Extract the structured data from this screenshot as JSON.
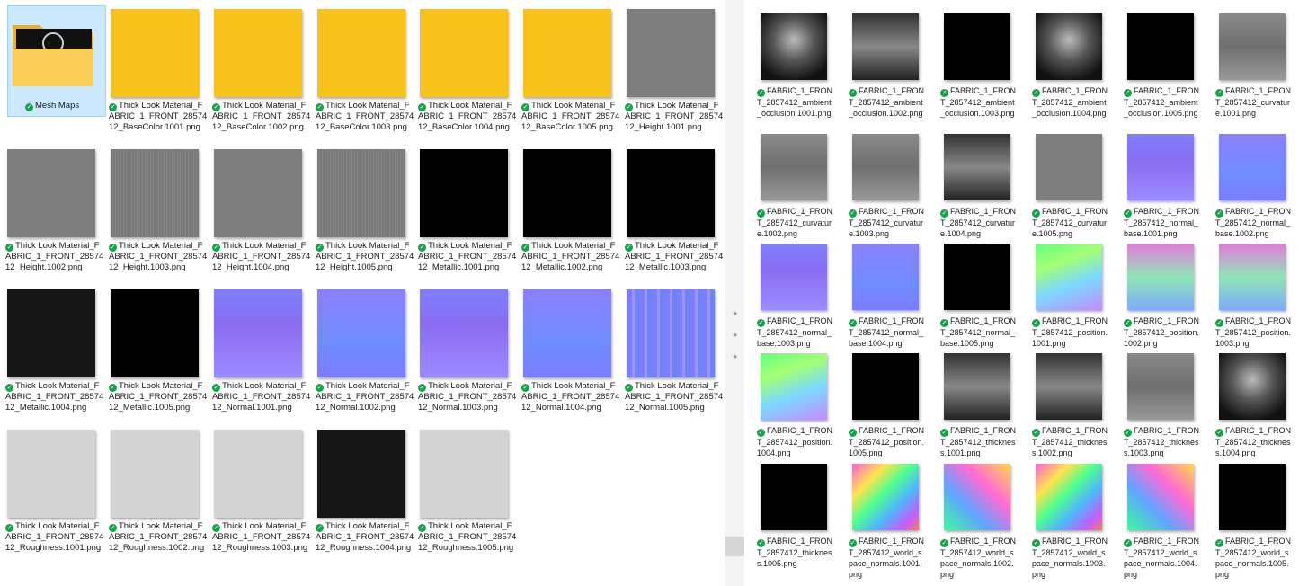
{
  "left_folder": {
    "folder_label": "Mesh Maps",
    "files": [
      {
        "name": "Thick Look Material_FABRIC_1_FRONT_2857412_BaseColor.1001.png",
        "pattern": "p-yellow"
      },
      {
        "name": "Thick Look Material_FABRIC_1_FRONT_2857412_BaseColor.1002.png",
        "pattern": "p-yellow"
      },
      {
        "name": "Thick Look Material_FABRIC_1_FRONT_2857412_BaseColor.1003.png",
        "pattern": "p-yellow"
      },
      {
        "name": "Thick Look Material_FABRIC_1_FRONT_2857412_BaseColor.1004.png",
        "pattern": "p-yellow-sun"
      },
      {
        "name": "Thick Look Material_FABRIC_1_FRONT_2857412_BaseColor.1005.png",
        "pattern": "p-yellow"
      },
      {
        "name": "Thick Look Material_FABRIC_1_FRONT_2857412_Height.1001.png",
        "pattern": "p-gray"
      },
      {
        "name": "Thick Look Material_FABRIC_1_FRONT_2857412_Height.1002.png",
        "pattern": "p-gray"
      },
      {
        "name": "Thick Look Material_FABRIC_1_FRONT_2857412_Height.1003.png",
        "pattern": "p-gray-stripe"
      },
      {
        "name": "Thick Look Material_FABRIC_1_FRONT_2857412_Height.1004.png",
        "pattern": "p-gray"
      },
      {
        "name": "Thick Look Material_FABRIC_1_FRONT_2857412_Height.1005.png",
        "pattern": "p-gray-stripe"
      },
      {
        "name": "Thick Look Material_FABRIC_1_FRONT_2857412_Metallic.1001.png",
        "pattern": "p-black"
      },
      {
        "name": "Thick Look Material_FABRIC_1_FRONT_2857412_Metallic.1002.png",
        "pattern": "p-black"
      },
      {
        "name": "Thick Look Material_FABRIC_1_FRONT_2857412_Metallic.1003.png",
        "pattern": "p-black"
      },
      {
        "name": "Thick Look Material_FABRIC_1_FRONT_2857412_Metallic.1004.png",
        "pattern": "p-dark"
      },
      {
        "name": "Thick Look Material_FABRIC_1_FRONT_2857412_Metallic.1005.png",
        "pattern": "p-black"
      },
      {
        "name": "Thick Look Material_FABRIC_1_FRONT_2857412_Normal.1001.png",
        "pattern": "p-normal"
      },
      {
        "name": "Thick Look Material_FABRIC_1_FRONT_2857412_Normal.1002.png",
        "pattern": "p-normal-b"
      },
      {
        "name": "Thick Look Material_FABRIC_1_FRONT_2857412_Normal.1003.png",
        "pattern": "p-normal"
      },
      {
        "name": "Thick Look Material_FABRIC_1_FRONT_2857412_Normal.1004.png",
        "pattern": "p-normal-b"
      },
      {
        "name": "Thick Look Material_FABRIC_1_FRONT_2857412_Normal.1005.png",
        "pattern": "p-normal-stripes"
      },
      {
        "name": "Thick Look Material_FABRIC_1_FRONT_2857412_Roughness.1001.png",
        "pattern": "p-light"
      },
      {
        "name": "Thick Look Material_FABRIC_1_FRONT_2857412_Roughness.1002.png",
        "pattern": "p-light"
      },
      {
        "name": "Thick Look Material_FABRIC_1_FRONT_2857412_Roughness.1003.png",
        "pattern": "p-light"
      },
      {
        "name": "Thick Look Material_FABRIC_1_FRONT_2857412_Roughness.1004.png",
        "pattern": "p-dark"
      },
      {
        "name": "Thick Look Material_FABRIC_1_FRONT_2857412_Roughness.1005.png",
        "pattern": "p-light"
      }
    ]
  },
  "right_folder": {
    "files": [
      {
        "name": "FABRIC_1_FRONT_2857412_ambient_occlusion.1001.png",
        "pattern": "p-ao"
      },
      {
        "name": "FABRIC_1_FRONT_2857412_ambient_occlusion.1002.png",
        "pattern": "p-mixed-dark"
      },
      {
        "name": "FABRIC_1_FRONT_2857412_ambient_occlusion.1003.png",
        "pattern": "p-black"
      },
      {
        "name": "FABRIC_1_FRONT_2857412_ambient_occlusion.1004.png",
        "pattern": "p-ao"
      },
      {
        "name": "FABRIC_1_FRONT_2857412_ambient_occlusion.1005.png",
        "pattern": "p-black"
      },
      {
        "name": "FABRIC_1_FRONT_2857412_curvature.1001.png",
        "pattern": "p-curv"
      },
      {
        "name": "FABRIC_1_FRONT_2857412_curvature.1002.png",
        "pattern": "p-curv"
      },
      {
        "name": "FABRIC_1_FRONT_2857412_curvature.1003.png",
        "pattern": "p-curv"
      },
      {
        "name": "FABRIC_1_FRONT_2857412_curvature.1004.png",
        "pattern": "p-mixed-dark"
      },
      {
        "name": "FABRIC_1_FRONT_2857412_curvature.1005.png",
        "pattern": "p-gray"
      },
      {
        "name": "FABRIC_1_FRONT_2857412_normal_base.1001.png",
        "pattern": "p-normal"
      },
      {
        "name": "FABRIC_1_FRONT_2857412_normal_base.1002.png",
        "pattern": "p-normal-b"
      },
      {
        "name": "FABRIC_1_FRONT_2857412_normal_base.1003.png",
        "pattern": "p-normal"
      },
      {
        "name": "FABRIC_1_FRONT_2857412_normal_base.1004.png",
        "pattern": "p-normal-b"
      },
      {
        "name": "FABRIC_1_FRONT_2857412_normal_base.1005.png",
        "pattern": "p-black"
      },
      {
        "name": "FABRIC_1_FRONT_2857412_position.1001.png",
        "pattern": "p-position"
      },
      {
        "name": "FABRIC_1_FRONT_2857412_position.1002.png",
        "pattern": "p-position-b"
      },
      {
        "name": "FABRIC_1_FRONT_2857412_position.1003.png",
        "pattern": "p-position-b"
      },
      {
        "name": "FABRIC_1_FRONT_2857412_position.1004.png",
        "pattern": "p-position"
      },
      {
        "name": "FABRIC_1_FRONT_2857412_position.1005.png",
        "pattern": "p-black"
      },
      {
        "name": "FABRIC_1_FRONT_2857412_thickness.1001.png",
        "pattern": "p-mixed-dark"
      },
      {
        "name": "FABRIC_1_FRONT_2857412_thickness.1002.png",
        "pattern": "p-mixed-dark"
      },
      {
        "name": "FABRIC_1_FRONT_2857412_thickness.1003.png",
        "pattern": "p-curv"
      },
      {
        "name": "FABRIC_1_FRONT_2857412_thickness.1004.png",
        "pattern": "p-ao"
      },
      {
        "name": "FABRIC_1_FRONT_2857412_thickness.1005.png",
        "pattern": "p-black"
      },
      {
        "name": "FABRIC_1_FRONT_2857412_world_space_normals.1001.png",
        "pattern": "p-spectrum"
      },
      {
        "name": "FABRIC_1_FRONT_2857412_world_space_normals.1002.png",
        "pattern": "p-spectrum-b"
      },
      {
        "name": "FABRIC_1_FRONT_2857412_world_space_normals.1003.png",
        "pattern": "p-spectrum"
      },
      {
        "name": "FABRIC_1_FRONT_2857412_world_space_normals.1004.png",
        "pattern": "p-spectrum-b"
      },
      {
        "name": "FABRIC_1_FRONT_2857412_world_space_normals.1005.png",
        "pattern": "p-black"
      }
    ]
  },
  "colors": {
    "selection_bg": "#cce8ff",
    "sync_check": "#16a34a",
    "folder_yellow": "#f9cc55"
  }
}
